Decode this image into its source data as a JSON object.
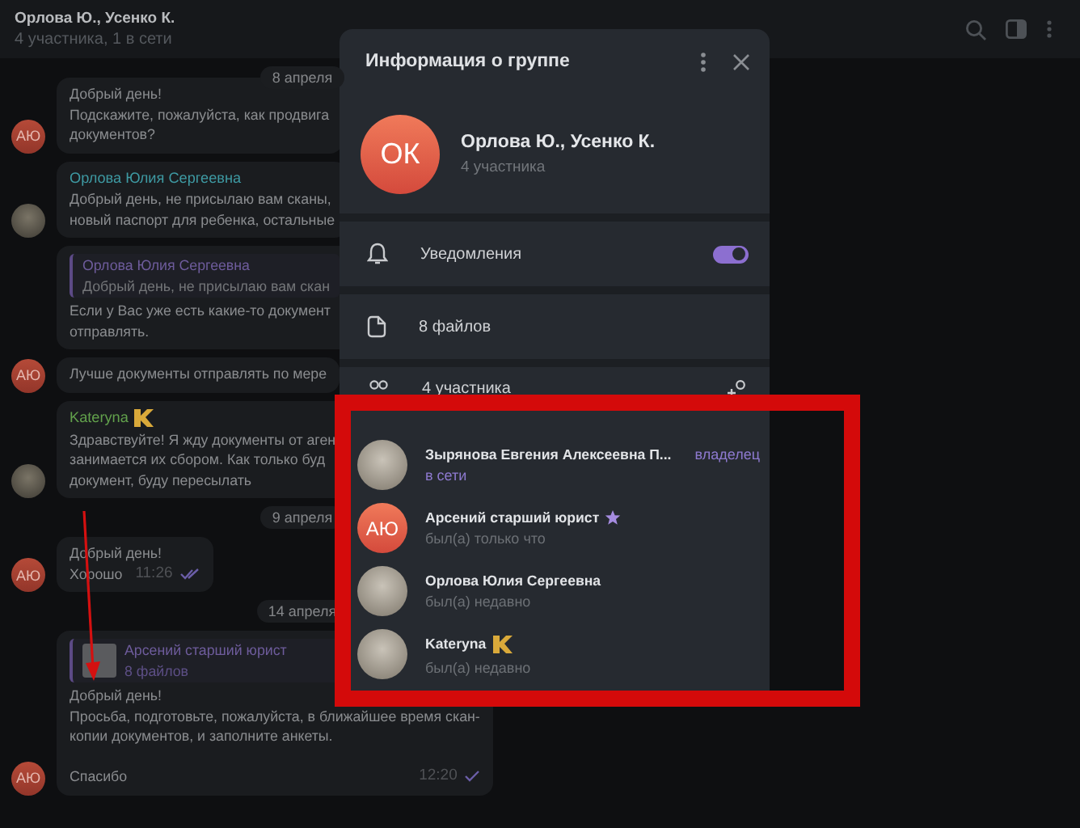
{
  "header": {
    "title": "Орлова Ю., Усенко К.",
    "subtitle": "4 участника, 1 в сети"
  },
  "chat": [
    {
      "kind": "date",
      "text": "8 апреля"
    },
    {
      "kind": "message",
      "avatar": {
        "kind": "initials",
        "text": "АЮ"
      },
      "paragraphs": [
        [
          "Добрый день!",
          "Подскажите, пожалуйста, как продвига",
          "документов?"
        ]
      ]
    },
    {
      "kind": "message",
      "avatar": {
        "kind": "photo"
      },
      "sender": "Орлова Юлия Сергеевна",
      "color": "#3e9aa3",
      "paragraphs": [
        [
          "Добрый день, не присылаю вам сканы,",
          "новый паспорт для ребенка, остальные"
        ]
      ]
    },
    {
      "kind": "message",
      "reply": {
        "kind": "text",
        "sender": "Орлова Юлия Сергеевна",
        "text": "Добрый день, не присылаю вам скан"
      },
      "paragraphs": [
        [
          "Если у Вас уже есть какие-то документ",
          "отправлять."
        ]
      ]
    },
    {
      "kind": "message",
      "avatar": {
        "kind": "initials",
        "text": "АЮ"
      },
      "paragraphs": [
        [
          "Лучше документы отправлять по мере"
        ]
      ]
    },
    {
      "kind": "message",
      "avatar": {
        "kind": "photo"
      },
      "sender": "Kateryna",
      "sender_badge": {
        "kind": "sticker"
      },
      "color": "#62a14c",
      "paragraphs": [
        [
          "Здравствуйте! Я жду документы от аген",
          "занимается их сбором. Как только буд",
          "документ, буду пересылать"
        ]
      ]
    },
    {
      "kind": "date",
      "text": "9 апреля"
    },
    {
      "kind": "message",
      "avatar": {
        "kind": "initials",
        "text": "АЮ"
      },
      "paragraphs": [
        [
          "Добрый день!",
          "Хорошо"
        ]
      ],
      "time": "11:26",
      "read": true
    },
    {
      "kind": "date",
      "text": "14 апреля"
    },
    {
      "kind": "message",
      "avatar": {
        "kind": "initials",
        "text": "АЮ"
      },
      "reply": {
        "kind": "file",
        "sender": "Арсений старший юрист",
        "text": "8 файлов"
      },
      "paragraphs": [
        [
          "Добрый день!",
          "Просьба, подготовьте, пожалуйста, в ближайшее время скан-",
          "копии документов, и заполните анкеты."
        ],
        [
          "Спасибо"
        ]
      ],
      "time": "12:20",
      "read": false
    }
  ],
  "group_info": {
    "title": "Информация о группе",
    "avatar_initials": "ОК",
    "name": "Орлова Ю., Усенко К.",
    "subtitle": "4 участника",
    "rows": [
      {
        "kind": "toggle",
        "label": "Уведомления",
        "on": true
      },
      {
        "kind": "files",
        "label": "8 файлов"
      }
    ],
    "members_title": "4 участника",
    "members": [
      {
        "name": "Зырянова Евгения Алексеевна П...",
        "status": "в сети",
        "online": true,
        "role": "владелец",
        "avatar": {
          "kind": "photo"
        }
      },
      {
        "name": "Арсений старший юрист",
        "badge": {
          "kind": "star"
        },
        "status": "был(а) только что",
        "online": false,
        "avatar": {
          "kind": "initials",
          "text": "АЮ"
        }
      },
      {
        "name": "Орлова Юлия Сергеевна",
        "status": "был(а) недавно",
        "online": false,
        "avatar": {
          "kind": "photo"
        }
      },
      {
        "name": "Kateryna",
        "badge": {
          "kind": "sticker"
        },
        "status": "был(а) недавно",
        "online": false,
        "avatar": {
          "kind": "photo"
        }
      }
    ]
  }
}
